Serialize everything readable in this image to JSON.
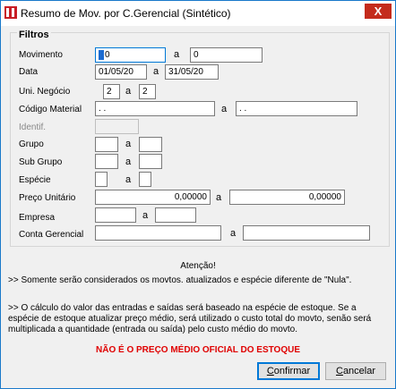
{
  "window": {
    "title": "Resumo de Mov. por C.Gerencial (Sintético)",
    "close_glyph": "X"
  },
  "filters": {
    "title": "Filtros",
    "separator": "a",
    "movimento": {
      "label": "Movimento",
      "from": "0",
      "to": "0"
    },
    "data": {
      "label": "Data",
      "from": "01/05/20",
      "to": "31/05/20"
    },
    "uni_negocio": {
      "label": "Uni. Negócio",
      "from": "2",
      "to": "2"
    },
    "codigo_material": {
      "label": "Código Material",
      "from": " .  .",
      "to": " .  ."
    },
    "identif": {
      "label": "Identif.",
      "value": ""
    },
    "grupo": {
      "label": "Grupo",
      "from": "",
      "to": ""
    },
    "sub_grupo": {
      "label": "Sub Grupo",
      "from": "",
      "to": ""
    },
    "especie": {
      "label": "Espécie",
      "from": "",
      "to": ""
    },
    "preco_unitario": {
      "label": "Preço Unitário",
      "from": "0,00000",
      "to": "0,00000"
    },
    "empresa": {
      "label": "Empresa",
      "from": "",
      "to": ""
    },
    "conta_gerencial": {
      "label": "Conta Gerencial",
      "from": "",
      "to": ""
    }
  },
  "notes": {
    "attention": "Atenção!",
    "line1": ">> Somente  serão  considerados os movtos. atualizados e espécie diferente de \"Nula\".",
    "line2": ">> O cálculo do valor das entradas e saídas será baseado na espécie de estoque. Se a espécie de estoque atualizar preço médio, será utilizado o custo total do movto, senão será multiplicada a quantidade (entrada ou saída) pelo custo médio do movto.",
    "warning": "NÃO É O PREÇO MÉDIO OFICIAL DO ESTOQUE"
  },
  "buttons": {
    "confirm": {
      "hotkey": "C",
      "rest": "onfirmar"
    },
    "cancel": {
      "hotkey": "C",
      "rest": "ancelar"
    }
  }
}
